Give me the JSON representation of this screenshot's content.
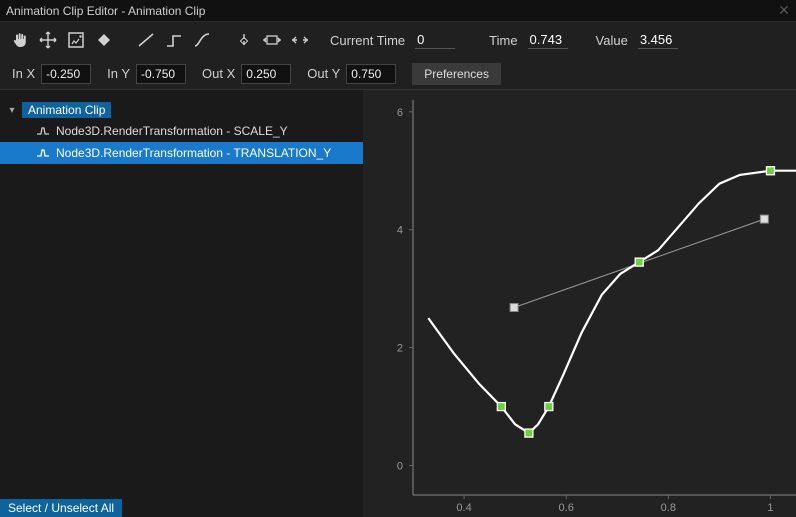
{
  "title": "Animation Clip Editor - Animation Clip",
  "toolbar": {
    "current_time_label": "Current Time",
    "current_time_value": "0",
    "time_label": "Time",
    "time_value": "0.743",
    "value_label": "Value",
    "value_value": "3.456"
  },
  "toolbar_icons": [
    "hand-icon",
    "move-icon",
    "frame-icon",
    "diamond-key-icon",
    "linear-tangent-icon",
    "step-tangent-icon",
    "curve-tangent-icon",
    "snap-key-icon",
    "fit-horizontal-icon",
    "fit-both-icon"
  ],
  "params": {
    "in_x_label": "In X",
    "in_x_value": "-0.250",
    "in_y_label": "In Y",
    "in_y_value": "-0.750",
    "out_x_label": "Out X",
    "out_x_value": "0.250",
    "out_y_label": "Out Y",
    "out_y_value": "0.750",
    "preferences_label": "Preferences"
  },
  "tree": {
    "root_label": "Animation Clip",
    "tracks": [
      {
        "label": "Node3D.RenderTransformation - SCALE_Y",
        "selected": false
      },
      {
        "label": "Node3D.RenderTransformation - TRANSLATION_Y",
        "selected": true
      }
    ],
    "select_all_label": "Select / Unselect All"
  },
  "chart_data": {
    "type": "line",
    "xlabel": "",
    "ylabel": "",
    "xlim": [
      0.3,
      1.05
    ],
    "ylim": [
      -0.5,
      6.2
    ],
    "x_ticks": [
      0.4,
      0.6,
      0.8,
      1
    ],
    "y_ticks": [
      0,
      2,
      4,
      6
    ],
    "keys": [
      {
        "x": 0.473,
        "y": 1.0
      },
      {
        "x": 0.527,
        "y": 0.55
      },
      {
        "x": 0.566,
        "y": 1.0
      },
      {
        "x": 0.743,
        "y": 3.45
      },
      {
        "x": 1.0,
        "y": 5.0
      }
    ],
    "tangent_handles": [
      {
        "x": 0.498,
        "y": 2.68
      },
      {
        "x": 0.988,
        "y": 4.18
      }
    ],
    "curve": [
      {
        "x": 0.33,
        "y": 2.5
      },
      {
        "x": 0.38,
        "y": 1.9
      },
      {
        "x": 0.43,
        "y": 1.38
      },
      {
        "x": 0.473,
        "y": 1.0
      },
      {
        "x": 0.5,
        "y": 0.7
      },
      {
        "x": 0.527,
        "y": 0.55
      },
      {
        "x": 0.545,
        "y": 0.7
      },
      {
        "x": 0.566,
        "y": 1.0
      },
      {
        "x": 0.595,
        "y": 1.55
      },
      {
        "x": 0.63,
        "y": 2.25
      },
      {
        "x": 0.67,
        "y": 2.9
      },
      {
        "x": 0.706,
        "y": 3.25
      },
      {
        "x": 0.743,
        "y": 3.45
      },
      {
        "x": 0.78,
        "y": 3.65
      },
      {
        "x": 0.82,
        "y": 4.05
      },
      {
        "x": 0.86,
        "y": 4.45
      },
      {
        "x": 0.9,
        "y": 4.78
      },
      {
        "x": 0.94,
        "y": 4.93
      },
      {
        "x": 1.0,
        "y": 5.0
      },
      {
        "x": 1.06,
        "y": 5.0
      }
    ]
  }
}
